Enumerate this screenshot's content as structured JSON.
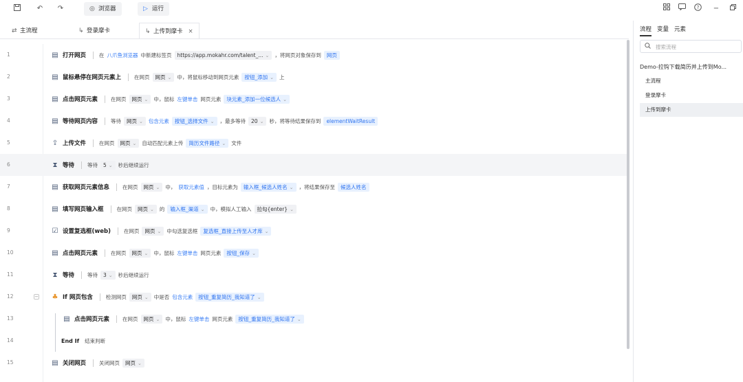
{
  "toolbar": {
    "browser_label": "浏览器",
    "run_label": "运行"
  },
  "tabs": [
    {
      "label": "主流程"
    },
    {
      "label": "登录摩卡"
    },
    {
      "label": "上传到摩卡"
    }
  ],
  "rows": [
    {
      "num": "1",
      "title": "打开网页",
      "parts": [
        {
          "k": "t",
          "v": "在"
        },
        {
          "k": "a",
          "v": "八爪鱼浏览器"
        },
        {
          "k": "t",
          "v": "中新建标签页"
        },
        {
          "k": "g",
          "v": "https://app.mokahr.com/talent_...",
          "dd": true
        },
        {
          "k": "t",
          "v": "，将网页对象保存到"
        },
        {
          "k": "b",
          "v": "网页"
        }
      ]
    },
    {
      "num": "2",
      "title": "鼠标悬停在网页元素上",
      "parts": [
        {
          "k": "t",
          "v": "在网页"
        },
        {
          "k": "g",
          "v": "网页",
          "dd": true
        },
        {
          "k": "t",
          "v": "中，将鼠标移动到网页元素"
        },
        {
          "k": "b",
          "v": "按钮_添加",
          "dd": true
        },
        {
          "k": "t",
          "v": "上"
        }
      ]
    },
    {
      "num": "3",
      "title": "点击网页元素",
      "parts": [
        {
          "k": "t",
          "v": "在网页"
        },
        {
          "k": "g",
          "v": "网页",
          "dd": true
        },
        {
          "k": "t",
          "v": "中，鼠标"
        },
        {
          "k": "a",
          "v": "左键单击"
        },
        {
          "k": "t",
          "v": "网页元素"
        },
        {
          "k": "b",
          "v": "块元素_添加一位候选人",
          "dd": true
        }
      ]
    },
    {
      "num": "4",
      "title": "等待网页内容",
      "parts": [
        {
          "k": "t",
          "v": "等待"
        },
        {
          "k": "g",
          "v": "网页",
          "dd": true
        },
        {
          "k": "a",
          "v": "包含元素"
        },
        {
          "k": "b",
          "v": "按钮_选择文件",
          "dd": true
        },
        {
          "k": "t",
          "v": "，最多等待"
        },
        {
          "k": "g",
          "v": "20",
          "dd": true
        },
        {
          "k": "t",
          "v": "秒，将等待结果保存到"
        },
        {
          "k": "b",
          "v": "elementWaitResult"
        }
      ]
    },
    {
      "num": "5",
      "title": "上传文件",
      "parts": [
        {
          "k": "t",
          "v": "在网页"
        },
        {
          "k": "g",
          "v": "网页",
          "dd": true
        },
        {
          "k": "t",
          "v": "自动匹配元素上传"
        },
        {
          "k": "b",
          "v": "简历文件路径",
          "dd": true
        },
        {
          "k": "t",
          "v": "文件"
        }
      ]
    },
    {
      "num": "6",
      "title": "等待",
      "hl": true,
      "parts": [
        {
          "k": "t",
          "v": "等待"
        },
        {
          "k": "g",
          "v": "5",
          "dd": true
        },
        {
          "k": "t",
          "v": "秒后继续运行"
        }
      ]
    },
    {
      "num": "7",
      "title": "获取网页元素信息",
      "parts": [
        {
          "k": "t",
          "v": "在网页"
        },
        {
          "k": "g",
          "v": "网页",
          "dd": true
        },
        {
          "k": "t",
          "v": "中，"
        },
        {
          "k": "a",
          "v": "获取元素值"
        },
        {
          "k": "t",
          "v": "，目标元素为"
        },
        {
          "k": "b",
          "v": "输入框_候选人姓名",
          "dd": true
        },
        {
          "k": "t",
          "v": "，将结果保存至"
        },
        {
          "k": "b",
          "v": "候选人姓名"
        }
      ]
    },
    {
      "num": "8",
      "title": "填写网页输入框",
      "parts": [
        {
          "k": "t",
          "v": "在网页"
        },
        {
          "k": "g",
          "v": "网页",
          "dd": true
        },
        {
          "k": "t",
          "v": "的"
        },
        {
          "k": "b",
          "v": "输入框_渠道",
          "dd": true
        },
        {
          "k": "t",
          "v": "中，模拟人工输入"
        },
        {
          "k": "g",
          "v": "拉勾{enter}",
          "dd": true
        }
      ]
    },
    {
      "num": "9",
      "title": "设置复选框(web)",
      "parts": [
        {
          "k": "t",
          "v": "在网页"
        },
        {
          "k": "g",
          "v": "网页",
          "dd": true
        },
        {
          "k": "t",
          "v": "中勾选复选框"
        },
        {
          "k": "b",
          "v": "复选框_直接上传至人才库",
          "dd": true
        }
      ]
    },
    {
      "num": "10",
      "title": "点击网页元素",
      "parts": [
        {
          "k": "t",
          "v": "在网页"
        },
        {
          "k": "g",
          "v": "网页",
          "dd": true
        },
        {
          "k": "t",
          "v": "中，鼠标"
        },
        {
          "k": "a",
          "v": "左键单击"
        },
        {
          "k": "t",
          "v": "网页元素"
        },
        {
          "k": "b",
          "v": "按钮_保存",
          "dd": true
        }
      ]
    },
    {
      "num": "11",
      "title": "等待",
      "parts": [
        {
          "k": "t",
          "v": "等待"
        },
        {
          "k": "g",
          "v": "3",
          "dd": true
        },
        {
          "k": "t",
          "v": "秒后继续运行"
        }
      ]
    },
    {
      "num": "12",
      "title": "If 网页包含",
      "fold": true,
      "orange": true,
      "parts": [
        {
          "k": "t",
          "v": "检测网页"
        },
        {
          "k": "g",
          "v": "网页",
          "dd": true
        },
        {
          "k": "t",
          "v": "中是否"
        },
        {
          "k": "a",
          "v": "包含元素"
        },
        {
          "k": "b",
          "v": "按钮_重复简历_我知道了",
          "dd": true
        }
      ]
    },
    {
      "num": "13",
      "title": "点击网页元素",
      "indent": true,
      "parts": [
        {
          "k": "t",
          "v": "在网页"
        },
        {
          "k": "g",
          "v": "网页",
          "dd": true
        },
        {
          "k": "t",
          "v": "中，鼠标"
        },
        {
          "k": "a",
          "v": "左键单击"
        },
        {
          "k": "t",
          "v": "网页元素"
        },
        {
          "k": "b",
          "v": "按钮_重复简历_我知道了",
          "dd": true
        }
      ]
    },
    {
      "num": "14",
      "title": "End If",
      "endif": true,
      "parts": [
        {
          "k": "t",
          "v": "结束判断"
        }
      ]
    },
    {
      "num": "15",
      "title": "关闭网页",
      "parts": [
        {
          "k": "t",
          "v": "关闭网页"
        },
        {
          "k": "g",
          "v": "网页",
          "dd": true
        }
      ]
    }
  ],
  "right_panel": {
    "tabs": [
      "流程",
      "变量",
      "元素"
    ],
    "search_placeholder": "搜索流程",
    "project_title": "Demo-拉钩下载简历并上传到Mo...",
    "items": [
      "主流程",
      "登录摩卡",
      "上传到摩卡"
    ]
  }
}
